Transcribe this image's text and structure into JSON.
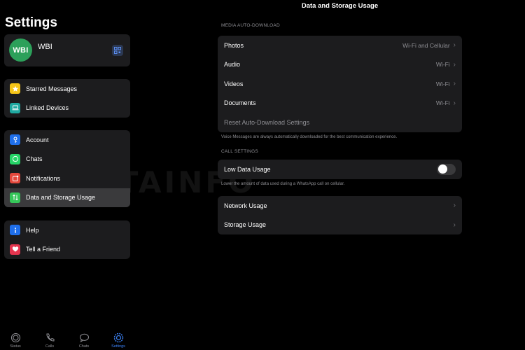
{
  "sidebar": {
    "title": "Settings",
    "profile": {
      "avatar_text": "WBI",
      "name": "WBI",
      "qr_icon": "qr-code-icon"
    },
    "group1": [
      {
        "label": "Starred Messages",
        "icon": "star-icon",
        "color": "#f5c518"
      },
      {
        "label": "Linked Devices",
        "icon": "laptop-icon",
        "color": "#1fa8a0"
      }
    ],
    "group2": [
      {
        "label": "Account",
        "icon": "key-icon",
        "color": "#1f6feb"
      },
      {
        "label": "Chats",
        "icon": "whatsapp-icon",
        "color": "#25d366"
      },
      {
        "label": "Notifications",
        "icon": "bell-icon",
        "color": "#e5483c"
      },
      {
        "label": "Data and Storage Usage",
        "icon": "arrows-icon",
        "color": "#35c759",
        "selected": true
      }
    ],
    "group3": [
      {
        "label": "Help",
        "icon": "info-icon",
        "color": "#1f6feb"
      },
      {
        "label": "Tell a Friend",
        "icon": "heart-icon",
        "color": "#e5354f"
      }
    ]
  },
  "tabbar": [
    {
      "label": "Status",
      "icon": "status-icon"
    },
    {
      "label": "Calls",
      "icon": "phone-icon"
    },
    {
      "label": "Chats",
      "icon": "chat-bubbles-icon"
    },
    {
      "label": "Settings",
      "icon": "gear-icon",
      "active": true
    }
  ],
  "main": {
    "title": "Data and Storage Usage",
    "media_header": "MEDIA AUTO-DOWNLOAD",
    "media_rows": [
      {
        "label": "Photos",
        "value": "Wi-Fi and Cellular"
      },
      {
        "label": "Audio",
        "value": "Wi-Fi"
      },
      {
        "label": "Videos",
        "value": "Wi-Fi"
      },
      {
        "label": "Documents",
        "value": "Wi-Fi"
      }
    ],
    "reset_label": "Reset Auto-Download Settings",
    "media_footnote": "Voice Messages are always automatically downloaded for the best communication experience.",
    "call_header": "CALL SETTINGS",
    "low_data_label": "Low Data Usage",
    "low_data_enabled": false,
    "call_footnote": "Lower the amount of data used during a WhatsApp call on cellular.",
    "usage_rows": [
      {
        "label": "Network Usage"
      },
      {
        "label": "Storage Usage"
      }
    ]
  },
  "watermark": "WABETAINFO",
  "colors": {
    "accent": "#3b82f6",
    "card_bg": "#1c1c1e",
    "selected_bg": "#3a3a3c",
    "muted": "#8e8e93"
  }
}
